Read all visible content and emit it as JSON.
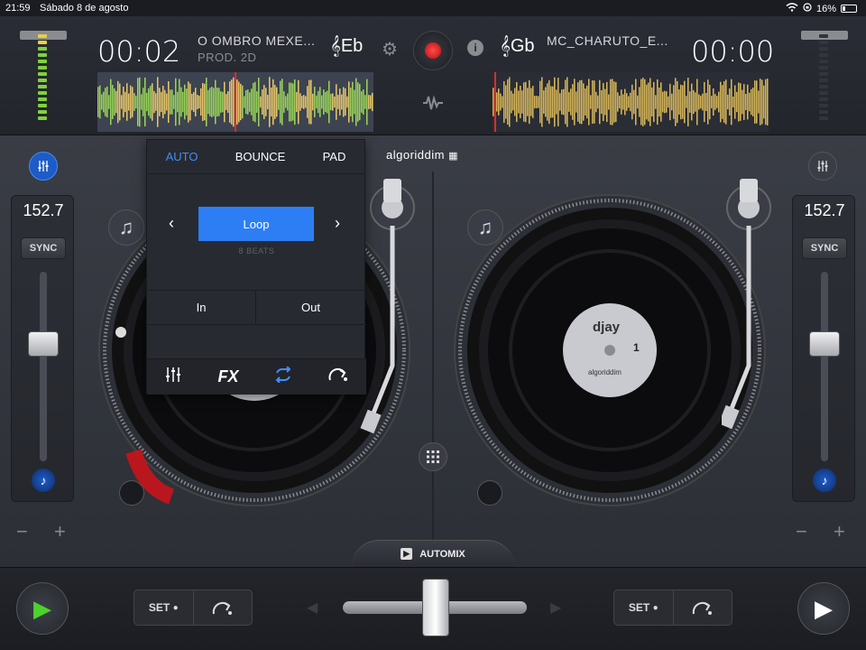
{
  "status": {
    "time": "21:59",
    "date": "Sábado 8 de agosto",
    "battery": "16%"
  },
  "deck_left": {
    "time": "00:02",
    "title": "O OMBRO MEXE...",
    "subtitle": "PROD. 2D",
    "key": "Eb",
    "bpm": "152.7",
    "sync_label": "SYNC"
  },
  "deck_right": {
    "time": "00:00",
    "title": "MC_CHARUTO_E...",
    "key": "Gb",
    "bpm": "152.7",
    "sync_label": "SYNC"
  },
  "brand": {
    "logo_text": "algoriddim"
  },
  "record_label": {
    "brand": "djay",
    "deck_number": "1",
    "small": "algoriddim"
  },
  "loop_panel": {
    "tabs": [
      "AUTO",
      "BOUNCE",
      "PAD"
    ],
    "active_tab": "AUTO",
    "loop_label": "Loop",
    "beats": "8 BEATS",
    "in_label": "In",
    "out_label": "Out",
    "fx_label": "FX"
  },
  "automix_label": "AUTOMIX",
  "set_label": "SET",
  "colors": {
    "accent": "#2d7ef4",
    "record": "#d11a1a",
    "play_green": "#4cd22a"
  },
  "icons": [
    "wifi-icon",
    "battery-icon",
    "gear-icon",
    "info-icon",
    "music-note-icon",
    "mixer-icon",
    "grid-icon",
    "loop-icon",
    "skip-icon",
    "play-icon"
  ]
}
